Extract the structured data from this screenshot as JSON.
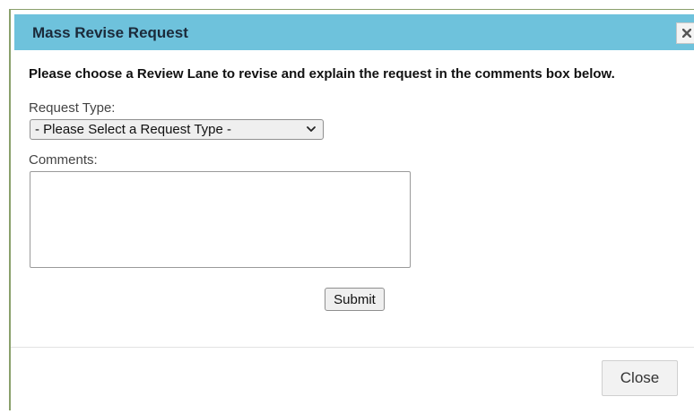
{
  "dialog": {
    "title": "Mass Revise Request",
    "close_icon": "close-icon",
    "instructions": "Please choose a Review Lane to revise and explain the request in the comments box below.",
    "request_type": {
      "label": "Request Type:",
      "selected": "- Please Select a Request Type -",
      "icon": "chevron-down-icon"
    },
    "comments": {
      "label": "Comments:",
      "value": ""
    },
    "submit_label": "Submit",
    "close_label": "Close"
  },
  "colors": {
    "titlebar": "#6ec2dc",
    "title_text": "#1b2a3a",
    "frame_border": "#8aa06c"
  }
}
